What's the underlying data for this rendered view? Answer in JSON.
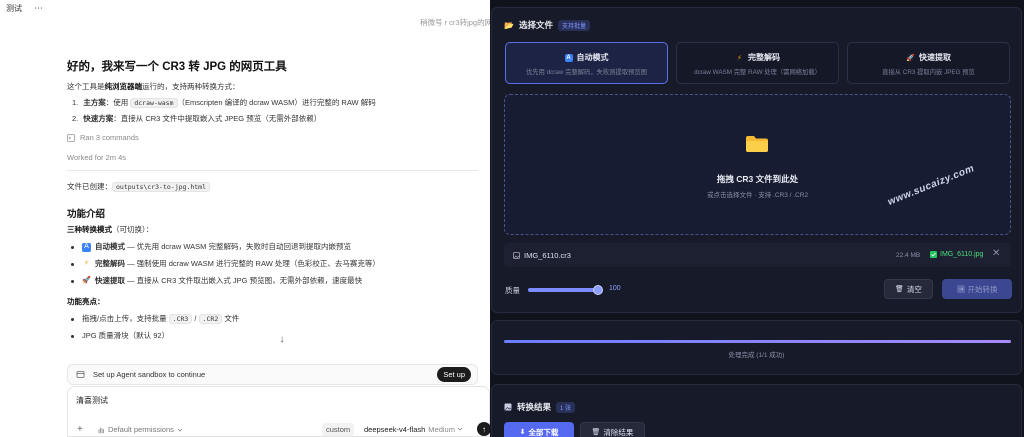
{
  "topbar": {
    "title": "测试",
    "menu_glyph": "⋯"
  },
  "context_hint": "稍微号   r cr3转jpg的网页",
  "chat": {
    "heading": "好的，我来写一个 CR3 转 JPG 的网页工具",
    "intro_pre": "这个工具是",
    "intro_bold": "纯浏览器端",
    "intro_post": "运行的，支持两种转换方式：",
    "steps": [
      {
        "num": "1.",
        "bold": "主方案",
        "pre": "：使用 ",
        "code": "dcraw-wasm",
        "post": "（Emscripten 编译的 dcraw WASM）进行完整的 RAW 解码"
      },
      {
        "num": "2.",
        "bold": "快速方案",
        "pre": "：直接从 CR3 文件中提取嵌入式 JPEG 预览（无需外部依赖）",
        "code": "",
        "post": ""
      }
    ],
    "ran_commands": "Ran 3 commands",
    "worked_for": "Worked for 2m 4s",
    "file_created_label": "文件已创建：",
    "file_created_path": "outputs\\cr3-to-jpg.html",
    "features_heading": "功能介绍",
    "modes_heading_bold": "三种转换模式",
    "modes_heading_rest": "（可切换）：",
    "modes": [
      {
        "icon": "🅰",
        "bold": "自动模式",
        "rest": " — 优先用 dcraw WASM 完整解码，失败时自动回退到提取内嵌预览"
      },
      {
        "icon": "⚡",
        "bold": "完整解码",
        "rest": " — 强制使用 dcraw WASM 进行完整的 RAW 处理（色彩校正、去马赛克等）"
      },
      {
        "icon": "🚀",
        "bold": "快速提取",
        "rest": " — 直接从 CR3 文件取出嵌入式 JPG 预览图，无需外部依赖，速度最快"
      }
    ],
    "highlights_heading": "功能亮点：",
    "highlights": [
      {
        "pre": "拖拽/点击上传，支持批量 ",
        "code1": ".CR3",
        "mid": " / ",
        "code2": ".CR2",
        "post": " 文件"
      },
      {
        "pre": "JPG 质量滑块（默认 92）",
        "code1": "",
        "mid": "",
        "code2": "",
        "post": ""
      }
    ]
  },
  "scroll_down_glyph": "↓",
  "sandbox": {
    "text": "Set up Agent sandbox to continue",
    "button": "Set up"
  },
  "composer": {
    "input_text": "清喜测试",
    "plus": "+",
    "permissions": "Default permissions",
    "custom": "custom",
    "model": "deepseek-v4-flash",
    "level": "Medium",
    "send": "↑"
  },
  "tool": {
    "accent": "#5b6fe6",
    "upload_title": "选择文件",
    "upload_badge": "支持批量",
    "modes": [
      {
        "icon": "🅰",
        "title": "自动模式",
        "desc": "优先用 dcraw 完整解码，失败则提取预览图",
        "active": true
      },
      {
        "icon": "⚡",
        "title": "完整解码",
        "desc": "dcraw WASM 完整 RAW 处理（需网络加载）",
        "active": false
      },
      {
        "icon": "🚀",
        "title": "快速提取",
        "desc": "直接从 CR3 提取内嵌 JPEG 预览",
        "active": false
      }
    ],
    "drop_title": "拖拽 CR3 文件到此处",
    "drop_sub": "或点击选择文件 · 支持 .CR3 / .CR2",
    "watermark": "www.sucaizy.com",
    "file": {
      "name": "IMG_6110.cr3",
      "size": "22.4 MB",
      "output": "IMG_6110.jpg",
      "close": "✕"
    },
    "quality_label": "质量",
    "quality_value": "100",
    "quality_fraction": 1.0,
    "clear_label": "清空",
    "start_label": "开始转换",
    "progress_fraction": 1.0,
    "progress_text": "处理完成 (1/1 成功)",
    "results_title": "转换结果",
    "results_count": "1 张",
    "download_all": "全部下载",
    "clear_results": "清除结果"
  }
}
